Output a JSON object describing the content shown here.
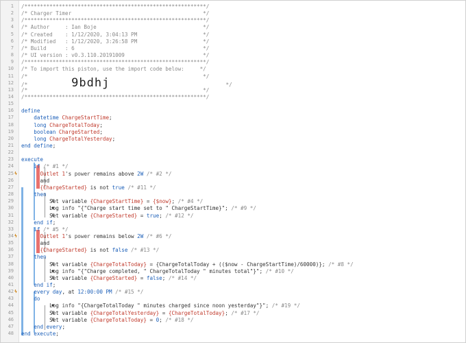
{
  "editor": {
    "lines": [
      {
        "n": "1",
        "segs": [
          [
            "c",
            "/**********************************************************/"
          ]
        ]
      },
      {
        "n": "2",
        "segs": [
          [
            "c",
            "/* Charger Timer                                          */"
          ]
        ]
      },
      {
        "n": "3",
        "segs": [
          [
            "c",
            "/**********************************************************/"
          ]
        ]
      },
      {
        "n": "4",
        "segs": [
          [
            "c",
            "/* Author     : Ian Boje                                  */"
          ]
        ]
      },
      {
        "n": "5",
        "segs": [
          [
            "c",
            "/* Created    : 1/12/2020, 3:04:13 PM                     */"
          ]
        ]
      },
      {
        "n": "6",
        "segs": [
          [
            "c",
            "/* Modified   : 1/12/2020, 3:26:58 PM                     */"
          ]
        ]
      },
      {
        "n": "7",
        "segs": [
          [
            "c",
            "/* Build      : 6                                         */"
          ]
        ]
      },
      {
        "n": "8",
        "segs": [
          [
            "c",
            "/* UI version : v0.3.110.20191009                         */"
          ]
        ]
      },
      {
        "n": "9",
        "segs": [
          [
            "c",
            "/**********************************************************/"
          ]
        ]
      },
      {
        "n": "10",
        "segs": [
          [
            "c",
            "/* To import this piston, use the import code below:     */"
          ]
        ]
      },
      {
        "n": "11",
        "segs": [
          [
            "c",
            "/*                                                        */"
          ]
        ]
      },
      {
        "n": "12",
        "segs": [
          [
            "c",
            "/*              "
          ],
          [
            "big",
            "9bdhj"
          ],
          [
            "c",
            "                                     */"
          ]
        ]
      },
      {
        "n": "13",
        "segs": [
          [
            "c",
            "/*                                                        */"
          ]
        ]
      },
      {
        "n": "14",
        "segs": [
          [
            "c",
            "/**********************************************************/"
          ]
        ]
      },
      {
        "n": "15",
        "segs": []
      },
      {
        "n": "16",
        "segs": [
          [
            "k",
            "define"
          ]
        ]
      },
      {
        "n": "17",
        "segs": [
          [
            "p",
            "    "
          ],
          [
            "t",
            "datetime "
          ],
          [
            "v",
            "ChargeStartTime"
          ],
          [
            "p",
            ";"
          ]
        ]
      },
      {
        "n": "18",
        "segs": [
          [
            "p",
            "    "
          ],
          [
            "t",
            "long "
          ],
          [
            "v",
            "ChargeTotalToday"
          ],
          [
            "p",
            ";"
          ]
        ]
      },
      {
        "n": "19",
        "segs": [
          [
            "p",
            "    "
          ],
          [
            "t",
            "boolean "
          ],
          [
            "v",
            "ChargeStarted"
          ],
          [
            "p",
            ";"
          ]
        ]
      },
      {
        "n": "20",
        "segs": [
          [
            "p",
            "    "
          ],
          [
            "t",
            "long "
          ],
          [
            "v",
            "ChargeTotalYesterday"
          ],
          [
            "p",
            ";"
          ]
        ]
      },
      {
        "n": "21",
        "segs": [
          [
            "k",
            "end define"
          ],
          [
            "p",
            ";"
          ]
        ]
      },
      {
        "n": "22",
        "segs": []
      },
      {
        "n": "23",
        "segs": [
          [
            "k",
            "execute"
          ]
        ]
      },
      {
        "n": "24",
        "segs": [
          [
            "p",
            "    "
          ],
          [
            "k",
            "if "
          ],
          [
            "c",
            "/* #1 */"
          ]
        ]
      },
      {
        "n": "25",
        "g": "ϟ",
        "segs": [
          [
            "p",
            "      "
          ],
          [
            "v",
            "Outlet 1"
          ],
          [
            "p",
            "'s "
          ],
          [
            "a",
            "power"
          ],
          [
            "p",
            " remains above "
          ],
          [
            "n",
            "2W"
          ],
          [
            "c",
            " /* #2 */"
          ]
        ]
      },
      {
        "n": "26",
        "segs": [
          [
            "p",
            "      "
          ],
          [
            "o",
            "and"
          ]
        ]
      },
      {
        "n": "27",
        "segs": [
          [
            "p",
            "      "
          ],
          [
            "v",
            "{ChargeStarted}"
          ],
          [
            "p",
            " is not "
          ],
          [
            "n",
            "true"
          ],
          [
            "c",
            " /* #11 */"
          ]
        ]
      },
      {
        "n": "28",
        "segs": [
          [
            "p",
            "    "
          ],
          [
            "k",
            "then"
          ]
        ]
      },
      {
        "n": "29",
        "segs": [
          [
            "p",
            "         Set variable "
          ],
          [
            "v",
            "{ChargeStartTime}"
          ],
          [
            "p",
            " = "
          ],
          [
            "v",
            "{$now}"
          ],
          [
            "p",
            ";"
          ],
          [
            "c",
            " /* #4 */"
          ]
        ]
      },
      {
        "n": "30",
        "segs": [
          [
            "p",
            "         Log "
          ],
          [
            "a",
            "info"
          ],
          [
            "p",
            " \"{\"Charge start time set to \" ChargeStartTime}\";"
          ],
          [
            "c",
            " /* #9 */"
          ]
        ]
      },
      {
        "n": "31",
        "segs": [
          [
            "p",
            "         Set variable "
          ],
          [
            "v",
            "{ChargeStarted}"
          ],
          [
            "p",
            " = "
          ],
          [
            "n",
            "true"
          ],
          [
            "p",
            ";"
          ],
          [
            "c",
            " /* #12 */"
          ]
        ]
      },
      {
        "n": "32",
        "segs": [
          [
            "p",
            "    "
          ],
          [
            "k",
            "end if"
          ],
          [
            "p",
            ";"
          ]
        ]
      },
      {
        "n": "33",
        "segs": [
          [
            "p",
            "    "
          ],
          [
            "k",
            "if "
          ],
          [
            "c",
            "/* #5 */"
          ]
        ]
      },
      {
        "n": "34",
        "g": "ϟ",
        "segs": [
          [
            "p",
            "      "
          ],
          [
            "v",
            "Outlet 1"
          ],
          [
            "p",
            "'s "
          ],
          [
            "a",
            "power"
          ],
          [
            "p",
            " remains below "
          ],
          [
            "n",
            "2W"
          ],
          [
            "c",
            " /* #6 */"
          ]
        ]
      },
      {
        "n": "35",
        "segs": [
          [
            "p",
            "      "
          ],
          [
            "o",
            "and"
          ]
        ]
      },
      {
        "n": "36",
        "segs": [
          [
            "p",
            "      "
          ],
          [
            "v",
            "{ChargeStarted}"
          ],
          [
            "p",
            " is not "
          ],
          [
            "n",
            "false"
          ],
          [
            "c",
            " /* #13 */"
          ]
        ]
      },
      {
        "n": "37",
        "segs": [
          [
            "p",
            "    "
          ],
          [
            "k",
            "then"
          ]
        ]
      },
      {
        "n": "38",
        "segs": [
          [
            "p",
            "         Set variable "
          ],
          [
            "v",
            "{ChargeTotalToday}"
          ],
          [
            "p",
            " = {ChargeTotalToday + (($now - ChargeStartTime)/60000)};"
          ],
          [
            "c",
            " /* #8 */"
          ]
        ]
      },
      {
        "n": "39",
        "segs": [
          [
            "p",
            "         Log "
          ],
          [
            "a",
            "info"
          ],
          [
            "p",
            " \"{\"Charge completed, \" ChargeTotalToday \" minutes total\"}\";"
          ],
          [
            "c",
            " /* #10 */"
          ]
        ]
      },
      {
        "n": "40",
        "segs": [
          [
            "p",
            "         Set variable "
          ],
          [
            "v",
            "{ChargeStarted}"
          ],
          [
            "p",
            " = "
          ],
          [
            "n",
            "false"
          ],
          [
            "p",
            ";"
          ],
          [
            "c",
            " /* #14 */"
          ]
        ]
      },
      {
        "n": "41",
        "segs": [
          [
            "p",
            "    "
          ],
          [
            "k",
            "end if"
          ],
          [
            "p",
            ";"
          ]
        ]
      },
      {
        "n": "42",
        "g": "ϟ",
        "segs": [
          [
            "p",
            "    "
          ],
          [
            "k",
            "every day"
          ],
          [
            "p",
            ", at "
          ],
          [
            "n",
            "12:00:00 PM"
          ],
          [
            "c",
            " /* #15 */"
          ]
        ]
      },
      {
        "n": "43",
        "segs": [
          [
            "p",
            "    "
          ],
          [
            "k",
            "do"
          ]
        ]
      },
      {
        "n": "44",
        "segs": [
          [
            "p",
            "         Log "
          ],
          [
            "a",
            "info"
          ],
          [
            "p",
            " \"{ChargeTotalToday \" minutes charged since noon yesterday\"}\";"
          ],
          [
            "c",
            " /* #19 */"
          ]
        ]
      },
      {
        "n": "45",
        "segs": [
          [
            "p",
            "         Set variable "
          ],
          [
            "v",
            "{ChargeTotalYesterday}"
          ],
          [
            "p",
            " = "
          ],
          [
            "v",
            "{ChargeTotalToday}"
          ],
          [
            "p",
            ";"
          ],
          [
            "c",
            " /* #17 */"
          ]
        ]
      },
      {
        "n": "46",
        "segs": [
          [
            "p",
            "         Set variable "
          ],
          [
            "v",
            "{ChargeTotalToday}"
          ],
          [
            "p",
            " = "
          ],
          [
            "n",
            "0"
          ],
          [
            "p",
            ";"
          ],
          [
            "c",
            " /* #18 */"
          ]
        ]
      },
      {
        "n": "47",
        "segs": [
          [
            "p",
            "    "
          ],
          [
            "k",
            "end every"
          ],
          [
            "p",
            ";"
          ]
        ]
      },
      {
        "n": "48",
        "segs": [
          [
            "k",
            "end execute"
          ],
          [
            "p",
            ";"
          ]
        ]
      }
    ],
    "statement_icons": [
      {
        "line": 29,
        "icon": "set-variable-icon",
        "glyph": "X"
      },
      {
        "line": 30,
        "icon": "log-icon",
        "glyph": "✱"
      },
      {
        "line": 31,
        "icon": "set-variable-icon",
        "glyph": "X"
      },
      {
        "line": 38,
        "icon": "set-variable-icon",
        "glyph": "X"
      },
      {
        "line": 39,
        "icon": "log-icon",
        "glyph": "✱"
      },
      {
        "line": 40,
        "icon": "set-variable-icon",
        "glyph": "X"
      },
      {
        "line": 44,
        "icon": "log-icon",
        "glyph": "✱"
      },
      {
        "line": 45,
        "icon": "set-variable-icon",
        "glyph": "X"
      },
      {
        "line": 46,
        "icon": "set-variable-icon",
        "glyph": "X"
      }
    ],
    "colors": {
      "keyword": "#1a5eb8",
      "variable": "#c0392b",
      "comment": "#888888",
      "block_blue": "#7fb2e5",
      "block_red": "#e8726f",
      "gutter_bg": "#f3f3f3"
    }
  }
}
